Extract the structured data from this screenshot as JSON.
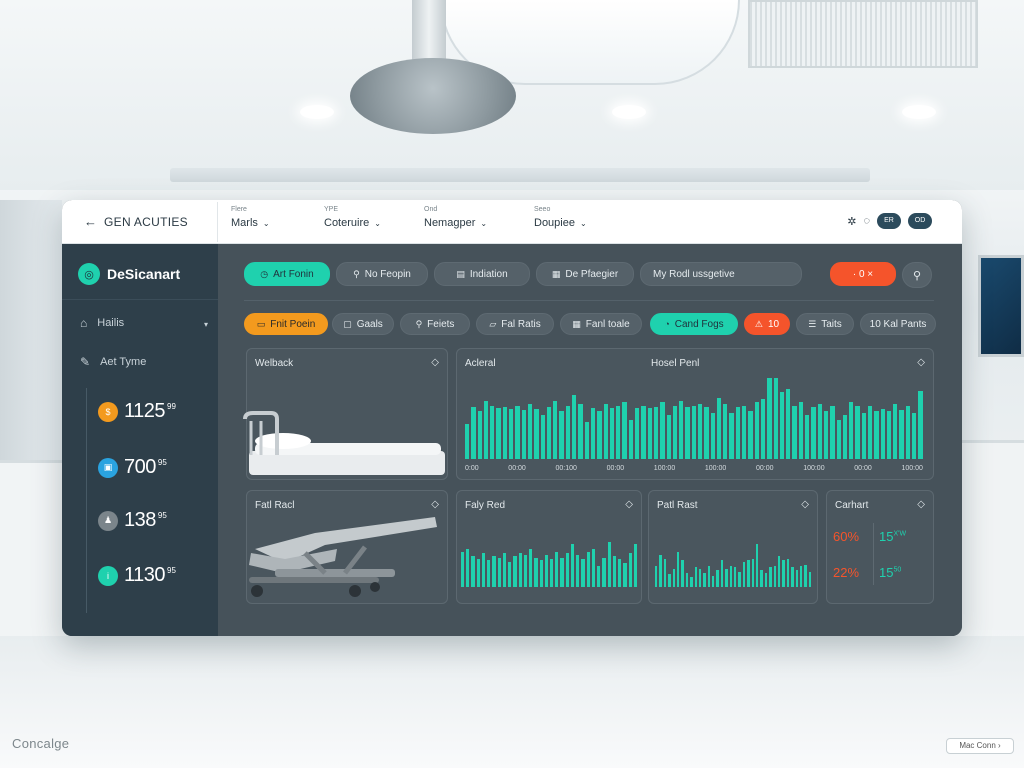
{
  "app": {
    "title": "GEN ACUTIES",
    "back_icon": "arrow-left-icon"
  },
  "filters": [
    {
      "caption": "Flere",
      "value": "Marls"
    },
    {
      "caption": "YPE",
      "value": "Coteruire"
    },
    {
      "caption": "Ond",
      "value": "Nemagper"
    },
    {
      "caption": "Seeo",
      "value": "Doupiee"
    }
  ],
  "top_icons": [
    "settings-icon",
    "refresh-icon"
  ],
  "top_pills": [
    "ER",
    "OD"
  ],
  "sidebar": {
    "title": "DeSicanart",
    "items": [
      {
        "label": "Hailis",
        "icon": "home-icon"
      },
      {
        "label": "Aet Tyme",
        "icon": "edit-icon"
      }
    ],
    "stats": [
      {
        "value": "1125",
        "sup": "99",
        "color": "#f39a1e"
      },
      {
        "value": "700",
        "sup": "95",
        "color": "#2aa3e0"
      },
      {
        "value": "138",
        "sup": "95",
        "color": "#7b858b"
      },
      {
        "value": "1130",
        "sup": "95",
        "color": "#1fd1ae"
      }
    ]
  },
  "toolbar_row1": [
    "Art Fonin",
    "No Feopin",
    "Indiation",
    "De Pfaegier",
    "My Rodl ussgetive",
    "· 0 ×"
  ],
  "toolbar_row2": [
    "Fnit Poein",
    "Gaals",
    "Feiets",
    "Fal Ratis",
    "Fanl toale",
    "Cand Fogs",
    "10",
    "Taits",
    "10 Kal Pants"
  ],
  "panels": {
    "p1_title": "Welback",
    "p2_title": "Acleral",
    "p2_subtitle": "Hosel Penl",
    "p3_title": "Fatl Racl",
    "p4_title": "Faly Red",
    "p5_title": "Patl Rast",
    "p6_title": "Carhart"
  },
  "chart_data": [
    {
      "type": "bar",
      "title": "Acleral",
      "subtitle": "Hosel Penl",
      "x_tick_labels": [
        "0:00",
        "00:00",
        "00:100",
        "00:00",
        "100:00",
        "100:00",
        "00:00",
        "100:00",
        "00:00",
        "100:00"
      ],
      "values": [
        38,
        56,
        52,
        63,
        58,
        55,
        57,
        54,
        58,
        53,
        60,
        54,
        48,
        57,
        63,
        52,
        58,
        70,
        60,
        40,
        55,
        52,
        60,
        55,
        58,
        62,
        42,
        55,
        58,
        55,
        57,
        62,
        48,
        58,
        63,
        56,
        58,
        60,
        56,
        50,
        66,
        60,
        50,
        56,
        58,
        52,
        62,
        65,
        88,
        88,
        73,
        76,
        58,
        62,
        48,
        57,
        60,
        52,
        58,
        42,
        48,
        62,
        58,
        50,
        58,
        52,
        54,
        52,
        60,
        53,
        58,
        50,
        74
      ]
    },
    {
      "type": "bar",
      "title": "Faly Red",
      "values": [
        50,
        55,
        45,
        40,
        48,
        38,
        45,
        42,
        48,
        36,
        44,
        48,
        46,
        54,
        42,
        38,
        46,
        40,
        50,
        42,
        48,
        62,
        46,
        40,
        50,
        55,
        30,
        42,
        64,
        45,
        40,
        35,
        48,
        62
      ]
    },
    {
      "type": "bar",
      "title": "Patl Rast",
      "values": [
        30,
        46,
        40,
        18,
        26,
        50,
        38,
        20,
        14,
        28,
        26,
        20,
        30,
        16,
        24,
        38,
        26,
        30,
        28,
        22,
        36,
        38,
        40,
        62,
        24,
        20,
        28,
        30,
        44,
        38,
        40,
        28,
        24,
        30,
        32,
        22
      ]
    }
  ],
  "kpis": {
    "title": "Carhart",
    "items": [
      {
        "left": "60%",
        "right": "15",
        "right_sup": "X'W"
      },
      {
        "left": "22%",
        "right": "15",
        "right_sup": "50"
      }
    ]
  },
  "footer": {
    "brand": "Concalge",
    "button": "Mac Conn ›"
  }
}
